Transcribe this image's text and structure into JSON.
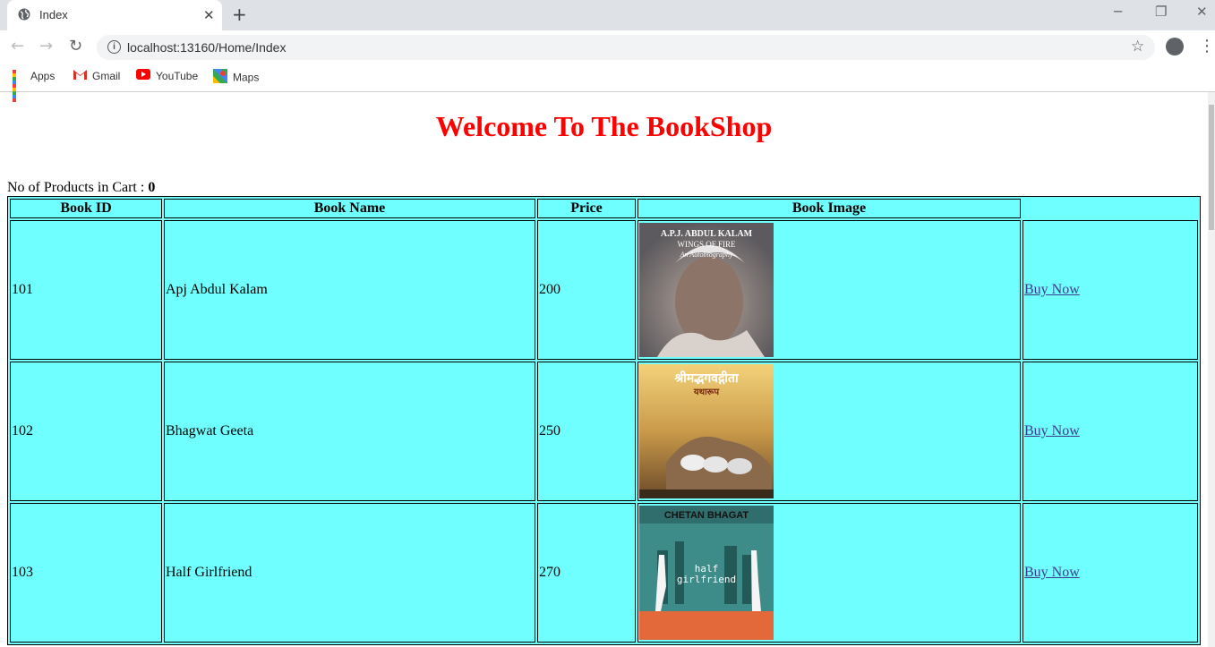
{
  "browser": {
    "tab_title": "Index",
    "url": "localhost:13160/Home/Index",
    "bookmarks": [
      {
        "label": "Apps",
        "icon": "apps-grid-icon"
      },
      {
        "label": "Gmail",
        "icon": "gmail-icon"
      },
      {
        "label": "YouTube",
        "icon": "youtube-icon"
      },
      {
        "label": "Maps",
        "icon": "maps-icon"
      }
    ]
  },
  "page": {
    "heading": "Welcome To The BookShop",
    "cart_label": "No of Products in Cart : ",
    "cart_count": "0",
    "table": {
      "headers": [
        "Book ID",
        "Book Name",
        "Price",
        "Book Image",
        ""
      ],
      "rows": [
        {
          "id": "101",
          "name": "Apj Abdul Kalam",
          "price": "200",
          "cover_lines": [
            "A.P.J. ABDUL KALAM",
            "WINGS OF FIRE",
            "An Autobiography"
          ],
          "action": "Buy Now"
        },
        {
          "id": "102",
          "name": "Bhagwat Geeta",
          "price": "250",
          "cover_lines": [
            "श्रीमद्भगवद्गीता",
            "यथारूप"
          ],
          "action": "Buy Now"
        },
        {
          "id": "103",
          "name": "Half Girlfriend",
          "price": "270",
          "cover_lines": [
            "CHETAN BHAGAT",
            "half",
            "girlfriend"
          ],
          "action": "Buy Now"
        }
      ]
    }
  },
  "colors": {
    "heading": "#ff0000",
    "table_bg": "#6fffff"
  }
}
